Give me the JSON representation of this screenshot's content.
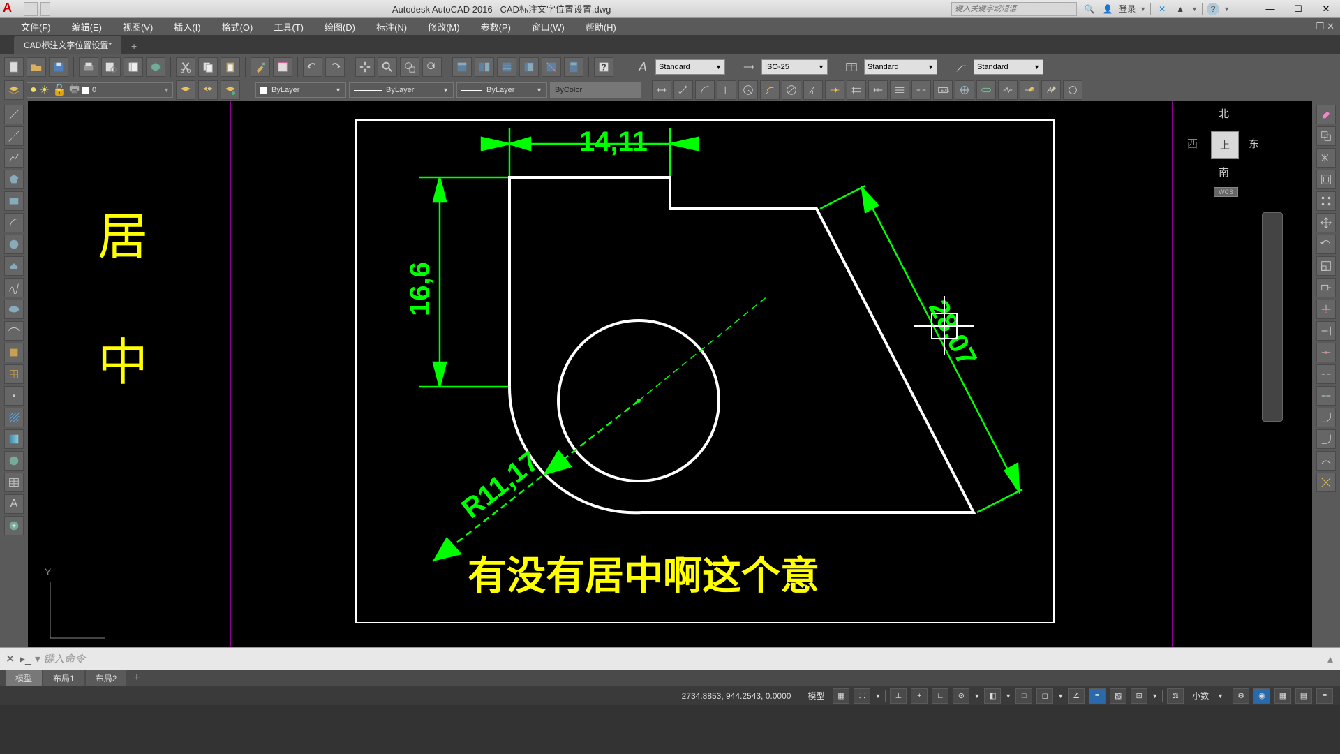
{
  "title": {
    "app": "Autodesk AutoCAD 2016",
    "file": "CAD标注文字位置设置.dwg"
  },
  "search": {
    "placeholder": "键入关键字或短语"
  },
  "account": {
    "label": "登录"
  },
  "menu": {
    "items": [
      "文件(F)",
      "编辑(E)",
      "视图(V)",
      "插入(I)",
      "格式(O)",
      "工具(T)",
      "绘图(D)",
      "标注(N)",
      "修改(M)",
      "参数(P)",
      "窗口(W)",
      "帮助(H)"
    ]
  },
  "tabs": {
    "active": "CAD标注文字位置设置*"
  },
  "styles": {
    "text_style": "Standard",
    "dim_style": "ISO-25",
    "table_style": "Standard",
    "mleader_style": "Standard"
  },
  "layer": {
    "current": "0"
  },
  "props": {
    "color": "ByLayer",
    "linetype": "ByLayer",
    "lineweight": "ByLayer",
    "plotstyle": "ByColor"
  },
  "viewcube": {
    "top": "上",
    "n": "北",
    "s": "南",
    "w": "西",
    "e": "东",
    "wcs": "WCS"
  },
  "drawing": {
    "dim_top": "14,11",
    "dim_left": "16,6",
    "dim_diag": "28,07",
    "dim_radius": "R11,17",
    "text_left1": "居",
    "text_left2": "中",
    "subtitle": "有没有居中啊这个意"
  },
  "ucs": {
    "y": "Y"
  },
  "command": {
    "placeholder": "键入命令"
  },
  "bottom_tabs": {
    "model": "模型",
    "layout1": "布局1",
    "layout2": "布局2"
  },
  "status": {
    "coords": "2734.8853, 944.2543, 0.0000",
    "model": "模型",
    "scale": "小数"
  },
  "colors": {
    "dim": "#00ff00",
    "anno": "#ffff00",
    "geom": "#ffffff"
  }
}
